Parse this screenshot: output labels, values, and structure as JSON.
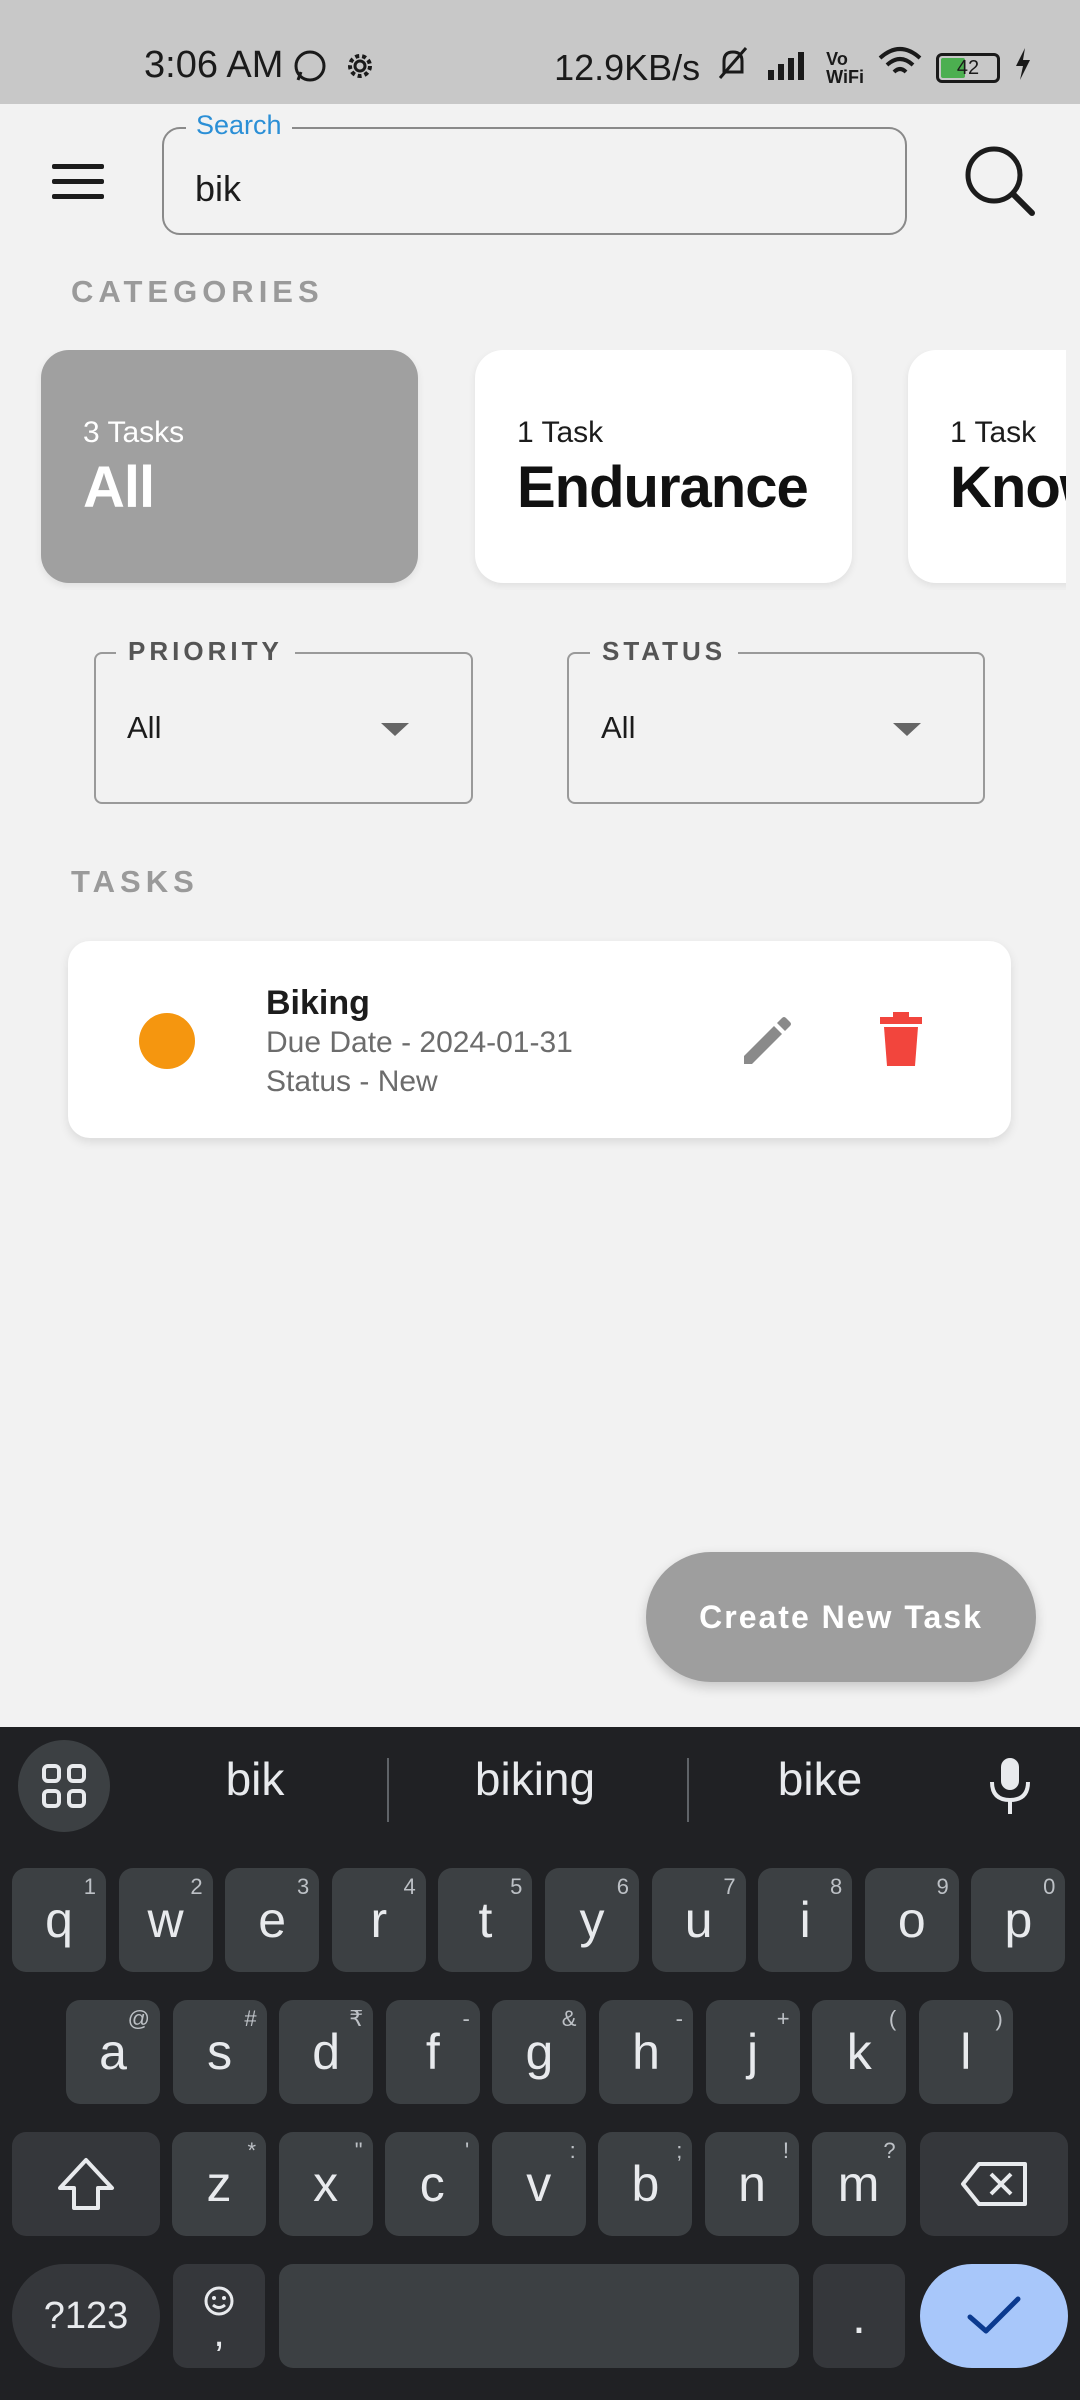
{
  "status_bar": {
    "time": "3:06 AM",
    "net_speed": "12.9KB/s",
    "battery": "42"
  },
  "header": {
    "search_label": "Search",
    "search_value": "bik"
  },
  "categories": {
    "label": "CATEGORIES",
    "items": [
      {
        "count": "3 Tasks",
        "name": "All",
        "selected": true
      },
      {
        "count": "1 Task",
        "name": "Endurance",
        "selected": false
      },
      {
        "count": "1 Task",
        "name": "Know",
        "selected": false
      }
    ]
  },
  "filters": {
    "priority": {
      "label": "PRIORITY",
      "value": "All"
    },
    "status": {
      "label": "STATUS",
      "value": "All"
    }
  },
  "tasks": {
    "label": "TASKS",
    "items": [
      {
        "title": "Biking",
        "due": "Due Date - 2024-01-31",
        "status": "Status - New",
        "priority_color": "#f5960f"
      }
    ]
  },
  "fab": {
    "label": "Create New Task"
  },
  "keyboard": {
    "suggestions": [
      "bik",
      "biking",
      "bike"
    ],
    "row1": [
      [
        "q",
        "1"
      ],
      [
        "w",
        "2"
      ],
      [
        "e",
        "3"
      ],
      [
        "r",
        "4"
      ],
      [
        "t",
        "5"
      ],
      [
        "y",
        "6"
      ],
      [
        "u",
        "7"
      ],
      [
        "i",
        "8"
      ],
      [
        "o",
        "9"
      ],
      [
        "p",
        "0"
      ]
    ],
    "row2": [
      [
        "a",
        "@"
      ],
      [
        "s",
        "#"
      ],
      [
        "d",
        "₹"
      ],
      [
        "f",
        "-"
      ],
      [
        "g",
        "&"
      ],
      [
        "h",
        "-"
      ],
      [
        "j",
        "+"
      ],
      [
        "k",
        "("
      ],
      [
        "l",
        ")"
      ]
    ],
    "row3": [
      [
        "z",
        "*"
      ],
      [
        "x",
        "\""
      ],
      [
        "c",
        "'"
      ],
      [
        "v",
        ":"
      ],
      [
        "b",
        ";"
      ],
      [
        "n",
        "!"
      ],
      [
        "m",
        "?"
      ]
    ],
    "symbols_key": "?123",
    "comma_key": ",",
    "period_key": "."
  },
  "colors": {
    "accent": "#2b8fd6",
    "delete": "#f2453d",
    "selected_category": "#a0a0a0",
    "fab": "#9e9e9e"
  }
}
